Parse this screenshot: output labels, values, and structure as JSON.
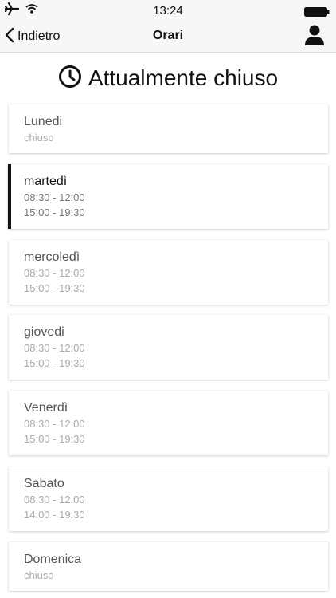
{
  "status_bar": {
    "time": "13:24",
    "icons": [
      "airplane-icon",
      "wifi-icon",
      "battery-icon"
    ]
  },
  "nav": {
    "back_label": "Indietro",
    "title": "Orari",
    "right_icon": "user-icon"
  },
  "heading": {
    "icon": "clock-icon",
    "text": "Attualmente chiuso"
  },
  "days": [
    {
      "name": "Lunedi",
      "lines": [
        "chiuso"
      ]
    },
    {
      "name": "martedì",
      "lines": [
        "08:30 - 12:00",
        "15:00 - 19:30"
      ],
      "active": true
    },
    {
      "name": "mercoledì",
      "lines": [
        "08:30 - 12:00",
        "15:00 - 19:30"
      ]
    },
    {
      "name": "giovedi",
      "lines": [
        "08:30 - 12:00",
        "15:00 - 19:30"
      ]
    },
    {
      "name": "Venerdì",
      "lines": [
        "08:30 - 12:00",
        "15:00 - 19:30"
      ]
    },
    {
      "name": "Sabato",
      "lines": [
        "08:30 - 12:00",
        "14:00 - 19:30"
      ]
    },
    {
      "name": "Domenica",
      "lines": [
        "chiuso"
      ]
    }
  ],
  "colors": {
    "active_indicator": "#111111",
    "muted_text": "#aaaaaa",
    "bar_background": "#f7f7f7"
  }
}
